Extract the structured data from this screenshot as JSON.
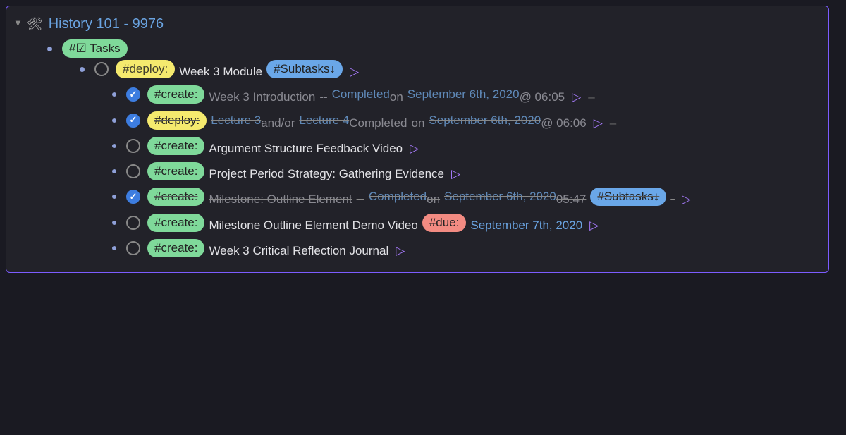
{
  "page": {
    "title": "History 101 - 9976"
  },
  "tags": {
    "tasks": "#☑ Tasks",
    "deploy": "#deploy:",
    "create": "#create:",
    "subtasks_down": "#Subtasks↓",
    "due": "#due:"
  },
  "tasks": {
    "root": {
      "title": "Week 3 Module"
    },
    "items": [
      {
        "tag": "create",
        "done": true,
        "text_a": "Week 3 Introduction",
        "sep": "--",
        "completed_label": "Completed",
        "on_label": "on",
        "date": "September 6th, 2020",
        "at": "@ 06:05",
        "trailing_dash": "–"
      },
      {
        "tag": "deploy",
        "done": true,
        "link_a": "Lecture 3",
        "andor": "and/or",
        "link_b": "Lecture 4",
        "completed_label": "Completed",
        "on_label": "on",
        "date": "September 6th, 2020",
        "at": "@ 06:06",
        "trailing_dash": "–"
      },
      {
        "tag": "create",
        "done": false,
        "text_a": "Argument Structure Feedback Video"
      },
      {
        "tag": "create",
        "done": false,
        "text_a": "Project Period Strategy: Gathering Evidence"
      },
      {
        "tag": "create",
        "done": true,
        "text_a": "Milestone: Outline Element",
        "sep": "--",
        "completed_label": "Completed",
        "on_label": "on",
        "date": "September 6th, 2020",
        "at": "05:47",
        "has_subtasks": true,
        "trailing_dash": "-"
      },
      {
        "tag": "create",
        "done": false,
        "text_a": "Milestone Outline Element Demo Video",
        "due_date": "September 7th, 2020"
      },
      {
        "tag": "create",
        "done": false,
        "text_a": "Week 3 Critical Reflection Journal"
      }
    ]
  }
}
